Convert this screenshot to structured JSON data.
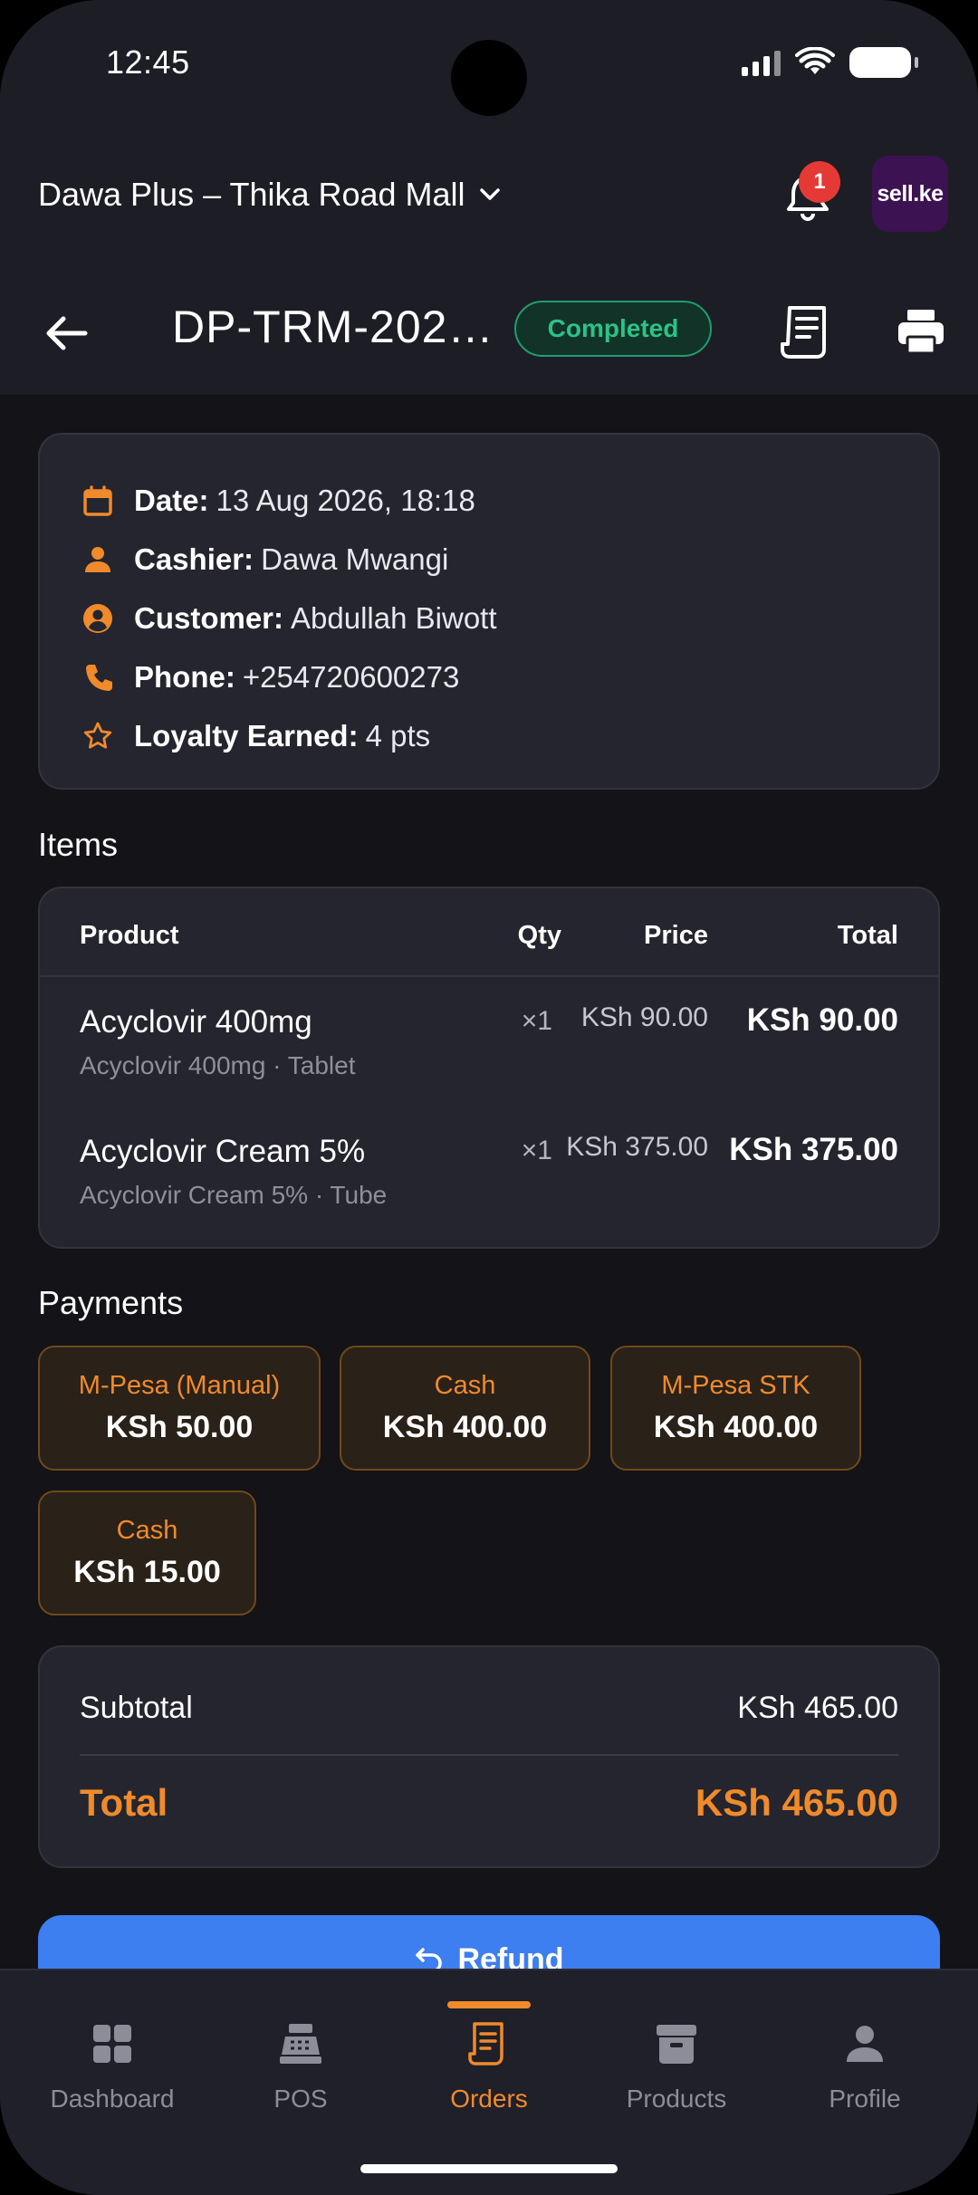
{
  "status_bar": {
    "time": "12:45"
  },
  "header": {
    "store_name": "Dawa Plus – Thika Road Mall",
    "notification_count": "1",
    "logo_text": "sell.ke"
  },
  "order": {
    "id": "DP-TRM-202…",
    "status": "Completed",
    "status_color": "#2bc28a"
  },
  "info": {
    "date_label": "Date:",
    "date": "13 Aug 2026, 18:18",
    "cashier_label": "Cashier:",
    "cashier": "Dawa Mwangi",
    "customer_label": "Customer:",
    "customer": "Abdullah Biwott",
    "phone_label": "Phone:",
    "phone": "+254720600273",
    "loyalty_label": "Loyalty Earned:",
    "loyalty": "4 pts"
  },
  "items": {
    "title": "Items",
    "columns": [
      "Product",
      "Qty",
      "Price",
      "Total"
    ],
    "rows": [
      {
        "name": "Acyclovir 400mg",
        "sub": "Acyclovir 400mg · Tablet",
        "qty": "×1",
        "price": "KSh 90.00",
        "total": "KSh 90.00"
      },
      {
        "name": "Acyclovir Cream 5%",
        "sub": "Acyclovir Cream 5% · Tube",
        "qty": "×1",
        "price": "KSh 375.00",
        "total": "KSh 375.00"
      }
    ]
  },
  "payments": {
    "title": "Payments",
    "list": [
      {
        "method": "M-Pesa (Manual)",
        "amount": "KSh 50.00"
      },
      {
        "method": "Cash",
        "amount": "KSh 400.00"
      },
      {
        "method": "M-Pesa STK",
        "amount": "KSh 400.00"
      },
      {
        "method": "Cash",
        "amount": "KSh 15.00"
      }
    ]
  },
  "totals": {
    "subtotal_label": "Subtotal",
    "subtotal": "KSh 465.00",
    "total_label": "Total",
    "total": "KSh 465.00"
  },
  "refund_label": "Refund",
  "nav": {
    "items": [
      {
        "label": "Dashboard",
        "icon": "dashboard-icon"
      },
      {
        "label": "POS",
        "icon": "cash-register-icon"
      },
      {
        "label": "Orders",
        "icon": "receipt-icon",
        "active": true
      },
      {
        "label": "Products",
        "icon": "archive-box-icon"
      },
      {
        "label": "Profile",
        "icon": "person-icon"
      }
    ]
  },
  "colors": {
    "accent": "#f08a2a",
    "primary_button": "#3d7ef0",
    "success": "#2bc28a"
  }
}
